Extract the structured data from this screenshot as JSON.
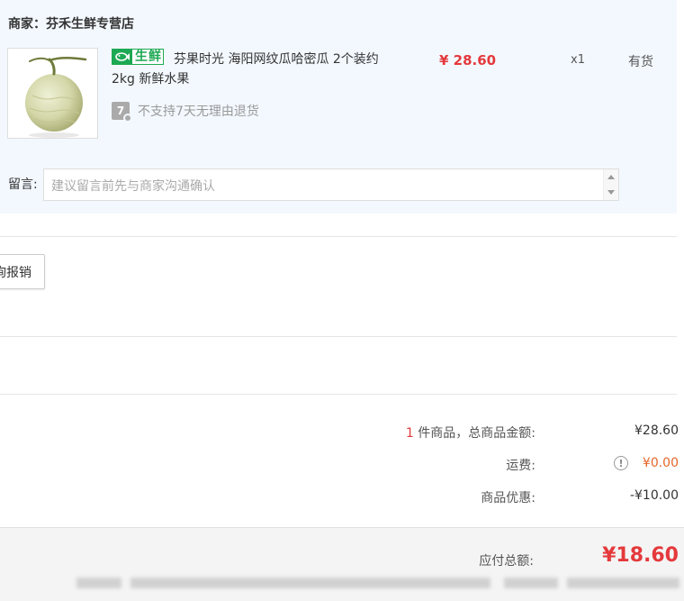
{
  "shop": {
    "label": "商家：芬禾生鲜专营店"
  },
  "product": {
    "badge": "生鲜",
    "title": "芬果时光 海阳网纹瓜哈密瓜 2个装约2kg 新鲜水果",
    "price": "¥ 28.60",
    "quantity": "x1",
    "stock": "有货",
    "return_notice": "不支持7天无理由退货",
    "return_icon_text": "7"
  },
  "note": {
    "label": "留言:",
    "placeholder": "建议留言前先与商家沟通确认"
  },
  "invoice": {
    "button_label": "询报销"
  },
  "summary": {
    "count": "1",
    "count_suffix": " 件商品，总商品金额:",
    "goods_total": "¥28.60",
    "shipping_label": "运费:",
    "shipping_value": "¥0.00",
    "discount_label": "商品优惠:",
    "discount_value": "-¥10.00"
  },
  "total": {
    "label": "应付总额:",
    "value": "¥18.60"
  },
  "colors": {
    "accent_red": "#e4393c",
    "fresh_green": "#1da853",
    "shipping_orange": "#e4672b",
    "panel_blue": "#f3f8fe"
  }
}
